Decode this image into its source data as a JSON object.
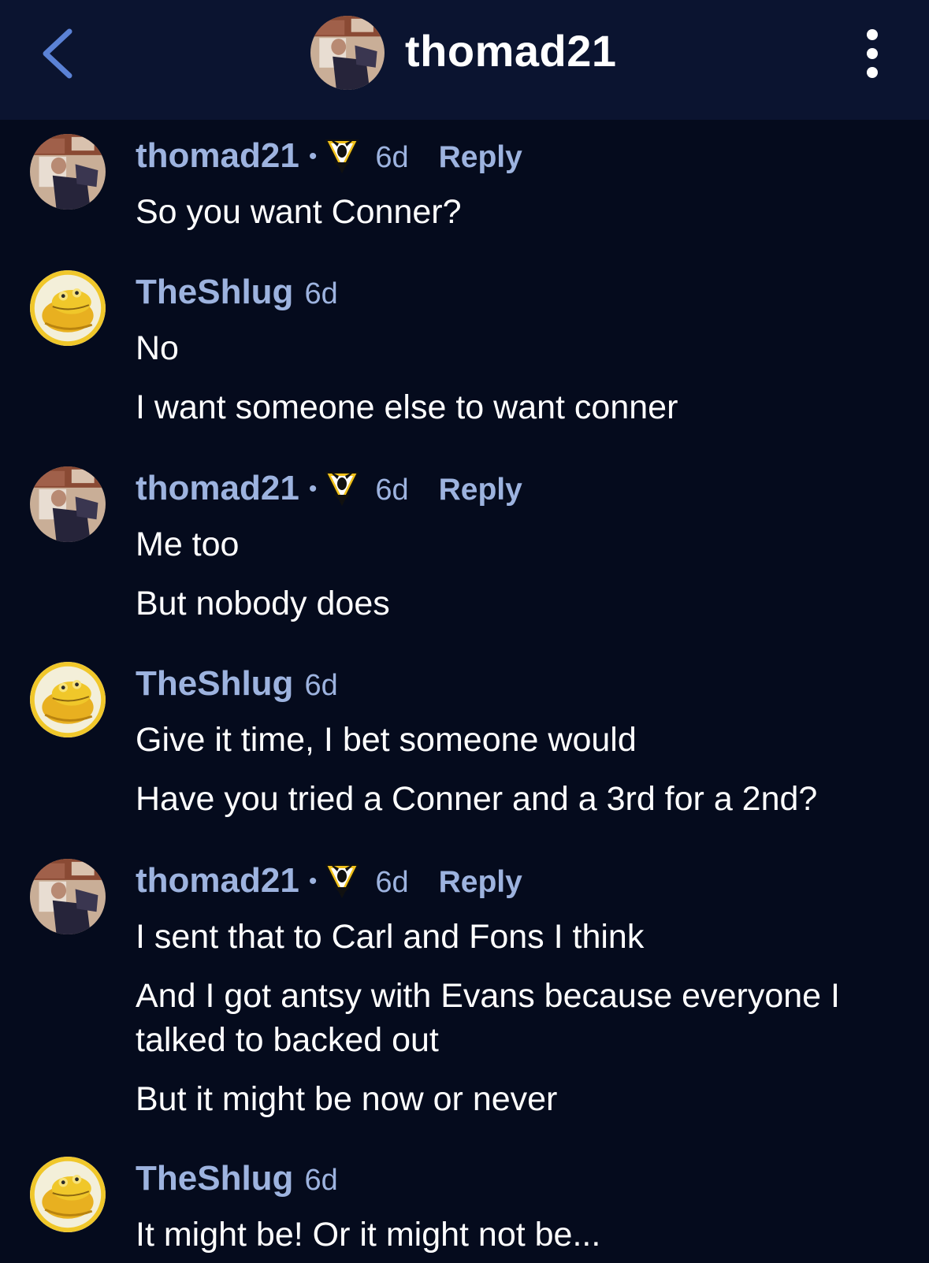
{
  "header": {
    "title": "thomad21",
    "back_icon": "chevron-left-icon",
    "menu_icon": "more-vertical-icon"
  },
  "colors": {
    "background": "#050b1d",
    "header_background": "#0b1430",
    "username": "#9db3df",
    "accent_blue": "#5b82d6"
  },
  "comments": [
    {
      "user": "thomad21",
      "flair": "penguins-logo-icon",
      "separator": "•",
      "time": "6d",
      "reply": "Reply",
      "lines": [
        "So you want Conner?"
      ]
    },
    {
      "user": "TheShlug",
      "time": "6d",
      "lines": [
        "No",
        "I want someone else to want conner"
      ]
    },
    {
      "user": "thomad21",
      "flair": "penguins-logo-icon",
      "separator": "•",
      "time": "6d",
      "reply": "Reply",
      "lines": [
        "Me too",
        "But nobody does"
      ]
    },
    {
      "user": "TheShlug",
      "time": "6d",
      "lines": [
        "Give it time, I bet someone would",
        "Have you tried a Conner and a 3rd for a 2nd?"
      ]
    },
    {
      "user": "thomad21",
      "flair": "penguins-logo-icon",
      "separator": "•",
      "time": "6d",
      "reply": "Reply",
      "lines": [
        "I sent that to Carl and Fons I think",
        "And I got antsy with Evans because everyone I talked to backed out",
        "But it might be now or never"
      ]
    },
    {
      "user": "TheShlug",
      "time": "6d",
      "lines": [
        "It might be! Or it might not be..."
      ]
    }
  ]
}
